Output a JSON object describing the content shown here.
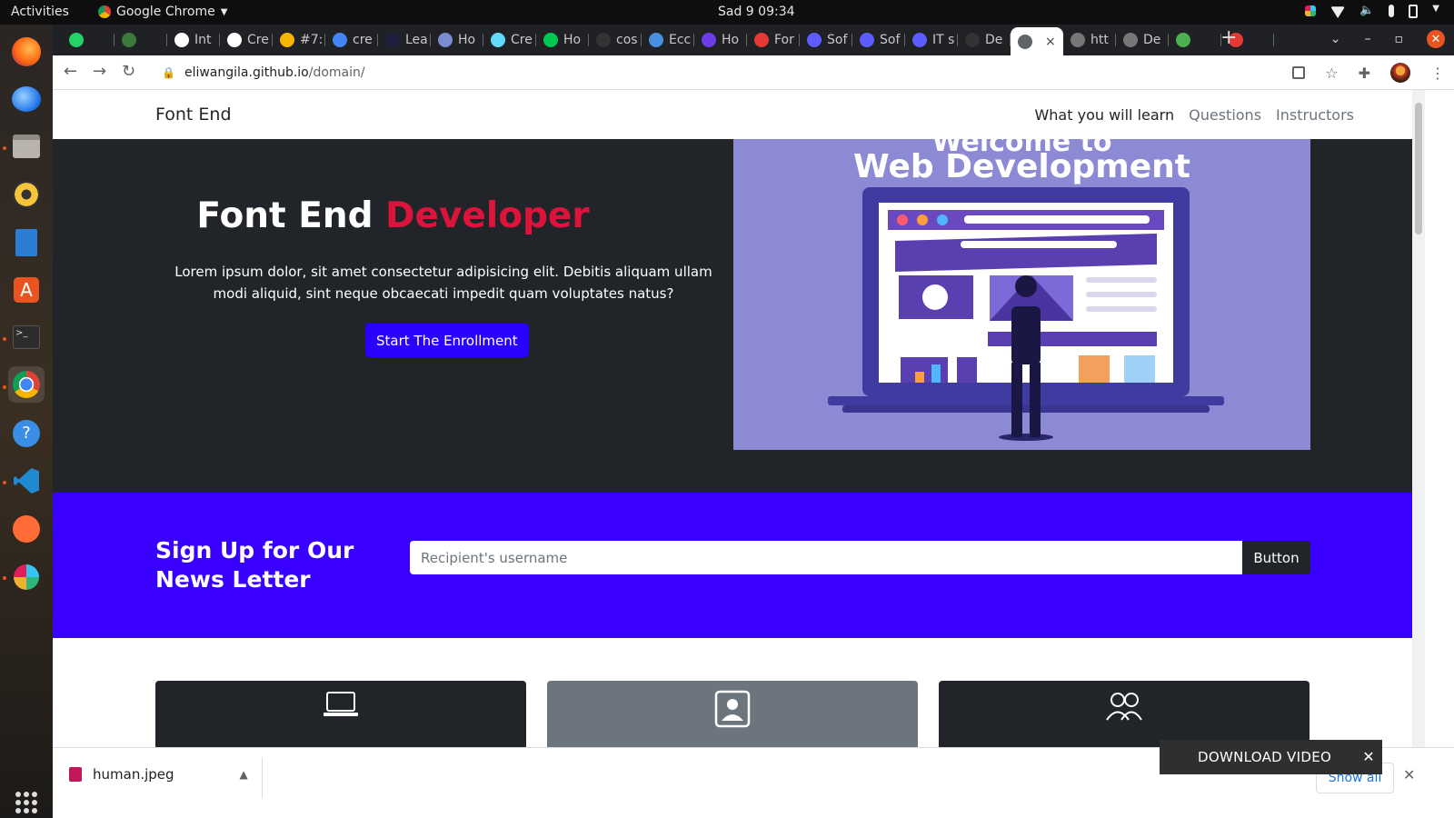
{
  "system": {
    "activities": "Activities",
    "app_name": "Google Chrome",
    "clock": "Sad 9  09:34"
  },
  "browser": {
    "tabs": [
      {
        "label": "",
        "color": "#25d366"
      },
      {
        "label": "",
        "color": "#3b7a3b"
      },
      {
        "label": "Int",
        "color": "#ffffff"
      },
      {
        "label": "Cre",
        "color": "#ffffff"
      },
      {
        "label": "#7:",
        "color": "#f4b400"
      },
      {
        "label": "cre",
        "color": "#4285f4"
      },
      {
        "label": "Lea",
        "color": "#1e1e3f"
      },
      {
        "label": "Ho",
        "color": "#7b8cd1"
      },
      {
        "label": "Cre",
        "color": "#61dafb"
      },
      {
        "label": "Ho",
        "color": "#00c853"
      },
      {
        "label": "cos",
        "color": "#333333"
      },
      {
        "label": "Ecc",
        "color": "#4a90e2"
      },
      {
        "label": "Ho",
        "color": "#6a3de8"
      },
      {
        "label": "For",
        "color": "#e53935"
      },
      {
        "label": "Sof",
        "color": "#5c5cff"
      },
      {
        "label": "Sof",
        "color": "#5c5cff"
      },
      {
        "label": "IT s",
        "color": "#5c5cff"
      },
      {
        "label": "De",
        "color": "#333333"
      }
    ],
    "active_tab_close": "×",
    "after_tabs": [
      {
        "label": "htt",
        "color": "#777777"
      },
      {
        "label": "De",
        "color": "#777777"
      },
      {
        "label": "",
        "color": "#4caf50"
      },
      {
        "label": "",
        "color": "#e53935"
      }
    ],
    "new_tab": "+",
    "url_host": "eliwangila.github.io",
    "url_path": "/domain/"
  },
  "site": {
    "brand": "Font End",
    "nav": [
      {
        "label": "What you will learn"
      },
      {
        "label": "Questions"
      },
      {
        "label": "Instructors"
      }
    ],
    "hero": {
      "title_main": "Font End ",
      "title_accent": "Developer",
      "lead": "Lorem ipsum dolor, sit amet consectetur adipisicing elit. Debitis aliquam ullam modi aliquid, sint neque obcaecati impedit quam voluptates natus?",
      "button": "Start The Enrollment",
      "image_heading_top": "Welcome to",
      "image_heading": "Web Development"
    },
    "newsletter": {
      "title": "Sign Up for Our News Letter",
      "placeholder": "Recipient's username",
      "button": "Button"
    },
    "features": {
      "icons": [
        "laptop-icon",
        "person-badge-icon",
        "people-icon"
      ]
    }
  },
  "downloads": {
    "file_name": "human.jpeg",
    "show_all": "Show all",
    "video_overlay": "DOWNLOAD VIDEO"
  }
}
